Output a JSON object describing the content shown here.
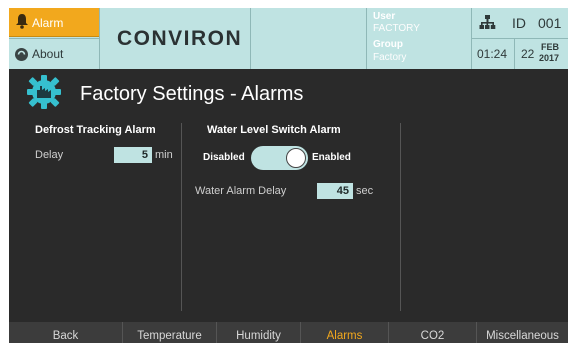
{
  "header": {
    "alarm_label": "Alarm",
    "about_label": "About",
    "logo": "CONVIRON",
    "user_label": "User",
    "user_value": "FACTORY",
    "group_label": "Group",
    "group_value": "Factory",
    "id_label": "ID",
    "id_value": "001",
    "time": "01:24",
    "day": "22",
    "month": "FEB",
    "year": "2017"
  },
  "page": {
    "title": "Factory Settings - Alarms"
  },
  "defrost": {
    "title": "Defrost Tracking Alarm",
    "delay_label": "Delay",
    "delay_value": "5",
    "delay_unit": "min"
  },
  "water": {
    "title": "Water Level Switch Alarm",
    "disabled_label": "Disabled",
    "enabled_label": "Enabled",
    "toggle_state": "Enabled",
    "delay_label": "Water Alarm Delay",
    "delay_value": "45",
    "delay_unit": "sec"
  },
  "nav": {
    "items": [
      {
        "label": "Back"
      },
      {
        "label": "Temperature"
      },
      {
        "label": "Humidity"
      },
      {
        "label": "Alarms"
      },
      {
        "label": "CO2"
      },
      {
        "label": "Miscellaneous"
      }
    ],
    "active": "Alarms"
  },
  "colors": {
    "accent": "#f2a81d",
    "panel": "#bfe3e2",
    "background": "#2a2a2a"
  }
}
